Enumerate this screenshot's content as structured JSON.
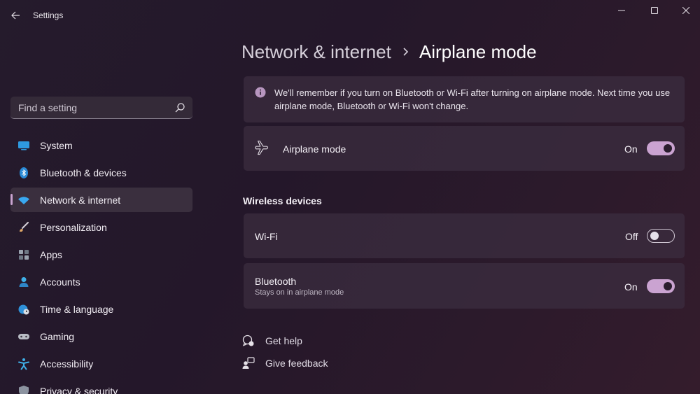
{
  "window": {
    "title": "Settings",
    "accent": "#caa3d1"
  },
  "search": {
    "placeholder": "Find a setting",
    "icon": "search-icon"
  },
  "sidebar": {
    "items": [
      {
        "label": "System",
        "icon": "monitor-icon",
        "active": false
      },
      {
        "label": "Bluetooth & devices",
        "icon": "bluetooth-icon",
        "active": false
      },
      {
        "label": "Network & internet",
        "icon": "wifi-icon",
        "active": true
      },
      {
        "label": "Personalization",
        "icon": "brush-icon",
        "active": false
      },
      {
        "label": "Apps",
        "icon": "apps-icon",
        "active": false
      },
      {
        "label": "Accounts",
        "icon": "person-icon",
        "active": false
      },
      {
        "label": "Time & language",
        "icon": "globe-clock-icon",
        "active": false
      },
      {
        "label": "Gaming",
        "icon": "gamepad-icon",
        "active": false
      },
      {
        "label": "Accessibility",
        "icon": "accessibility-icon",
        "active": false
      },
      {
        "label": "Privacy & security",
        "icon": "shield-icon",
        "active": false
      }
    ]
  },
  "breadcrumb": {
    "parent": "Network & internet",
    "current": "Airplane mode"
  },
  "info": {
    "text": "We'll remember if you turn on Bluetooth or Wi-Fi after turning on airplane mode. Next time you use airplane mode, Bluetooth or Wi-Fi won't change."
  },
  "airplane_mode": {
    "label": "Airplane mode",
    "state": "On",
    "on": true
  },
  "wireless": {
    "title": "Wireless devices",
    "wifi": {
      "label": "Wi-Fi",
      "state": "Off",
      "on": false
    },
    "bluetooth": {
      "label": "Bluetooth",
      "sublabel": "Stays on in airplane mode",
      "state": "On",
      "on": true
    }
  },
  "links": {
    "help": "Get help",
    "feedback": "Give feedback"
  }
}
